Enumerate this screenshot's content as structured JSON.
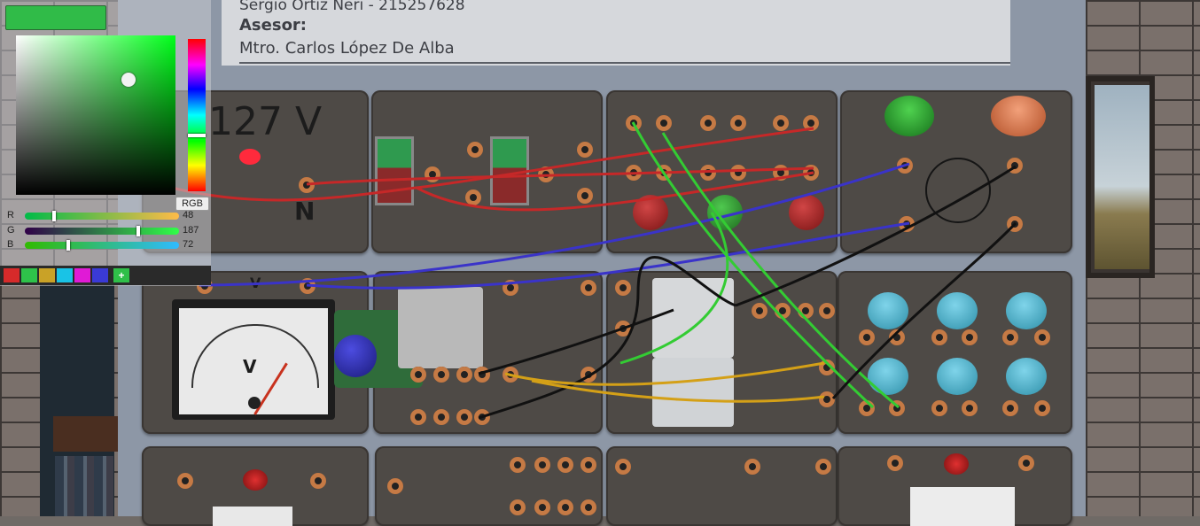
{
  "header": {
    "student_line": "Sergio Ortiz Neri - 215257628",
    "advisor_label": "Asesor:",
    "advisor_name": "Mtro. Carlos López De Alba"
  },
  "panel_labels": {
    "voltage": "127 V",
    "neutral": "N",
    "voltmeter_terminal": "V",
    "voltmeter_symbol": "V"
  },
  "color_picker": {
    "current_color": "#30bb48",
    "mode_label": "RGB",
    "channels": [
      {
        "label": "R",
        "value": "48",
        "fraction": 0.188
      },
      {
        "label": "G",
        "value": "187",
        "fraction": 0.733
      },
      {
        "label": "B",
        "value": "72",
        "fraction": 0.282
      }
    ],
    "palette": [
      "#d62a2a",
      "#2ec24a",
      "#c9a227",
      "#19c3e6",
      "#e01ad6",
      "#3a3ad6"
    ],
    "add_label": "+"
  }
}
